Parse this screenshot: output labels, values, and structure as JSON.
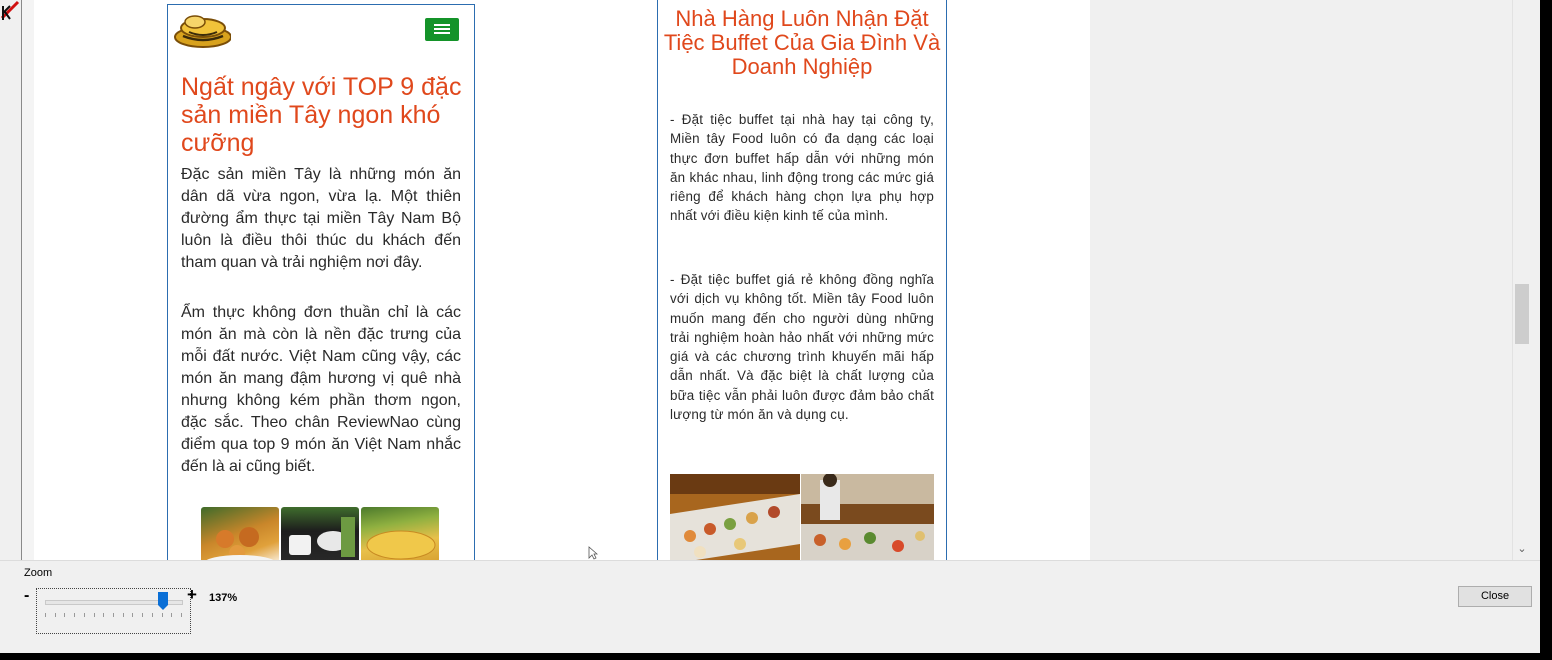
{
  "page1": {
    "title": "Ngất ngây với TOP 9 đặc sản miền Tây ngon khó cưỡng",
    "para1": "Đặc sản miền Tây là những món ăn dân dã vừa ngon, vừa lạ. Một thiên đường ẩm thực tại miền Tây Nam Bộ luôn là điều thôi thúc du khách đến tham quan và trải nghiệm nơi đây.",
    "para2": "Ẩm thực không đơn thuần chỉ là các món ăn mà còn là nền đặc trưng của mỗi đất nước. Việt Nam cũng vậy, các món ăn mang đậm hương vị quê nhà nhưng không kém phần thơm ngon, đặc sắc. Theo chân ReviewNao cùng điểm qua top 9 món ăn Việt Nam nhắc đến là ai cũng biết."
  },
  "page2": {
    "title": "Nhà Hàng Luôn Nhận Đặt Tiệc Buffet Của Gia Đình Và Doanh Nghiệp",
    "para1": "- Đặt tiệc buffet tại nhà hay tại công ty, Miền tây Food luôn có đa dạng các loại thực đơn buffet hấp dẫn với những món ăn khác nhau, linh động trong các mức giá riêng để khách hàng chọn lựa phụ hợp nhất với điều kiện kinh tế của mình.",
    "para2": "- Đặt tiệc buffet giá rẻ không đồng nghĩa với dịch vụ không tốt. Miền tây Food luôn muốn mang đến cho người dùng những trải nghiệm hoàn hảo nhất với những mức giá và các chương trình khuyến mãi hấp dẫn nhất. Và đặc biệt là chất lượng của bữa tiệc vẫn phải luôn được đảm bảo chất lượng từ món ăn và dụng cụ."
  },
  "zoom": {
    "label": "Zoom",
    "minus": "-",
    "plus": "+",
    "value": "137%",
    "level_fraction": 0.87
  },
  "close_label": "Close",
  "colors": {
    "heading": "#e0481c",
    "border": "#2c6db0",
    "menu_button": "#149329",
    "slider_thumb": "#0a6fd6"
  }
}
